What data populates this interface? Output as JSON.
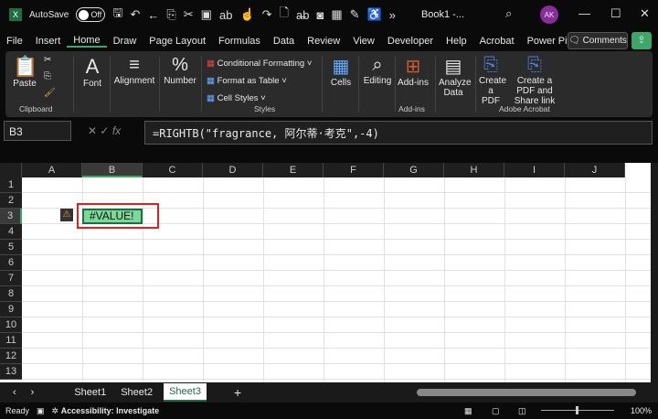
{
  "titlebar": {
    "autosave_label": "AutoSave",
    "autosave_state": "Off",
    "title": "Book1 -...",
    "user_initials": "AK"
  },
  "menu": [
    "File",
    "Insert",
    "Home",
    "Draw",
    "Page Layout",
    "Formulas",
    "Data",
    "Review",
    "View",
    "Developer",
    "Help",
    "Acrobat",
    "Power Pivot"
  ],
  "comments_label": "Comments",
  "ribbon": {
    "paste": "Paste",
    "clipboard": "Clipboard",
    "font": "Font",
    "alignment": "Alignment",
    "number": "Number",
    "conditional": "Conditional Formatting",
    "format_table": "Format as Table",
    "cell_styles": "Cell Styles",
    "styles": "Styles",
    "cells": "Cells",
    "editing": "Editing",
    "addins": "Add-ins",
    "addins_group": "Add-ins",
    "analyze": "Analyze Data",
    "create_pdf": "Create a PDF",
    "create_share": "Create a PDF and Share link",
    "adobe": "Adobe Acrobat"
  },
  "formula_bar": {
    "name_box": "B3",
    "formula": "=RIGHTB(\"fragrance, 阿尔蒂·考克\",-4)"
  },
  "columns": [
    "A",
    "B",
    "C",
    "D",
    "E",
    "F",
    "G",
    "H",
    "I",
    "J"
  ],
  "rows": [
    "1",
    "2",
    "3",
    "4",
    "5",
    "6",
    "7",
    "8",
    "9",
    "10",
    "11",
    "12",
    "13"
  ],
  "cell_B3": "#VALUE!",
  "sheets": [
    "Sheet1",
    "Sheet2",
    "Sheet3"
  ],
  "active_sheet": "Sheet3",
  "status": {
    "ready": "Ready",
    "accessibility": "Accessibility: Investigate",
    "zoom": "100%"
  }
}
